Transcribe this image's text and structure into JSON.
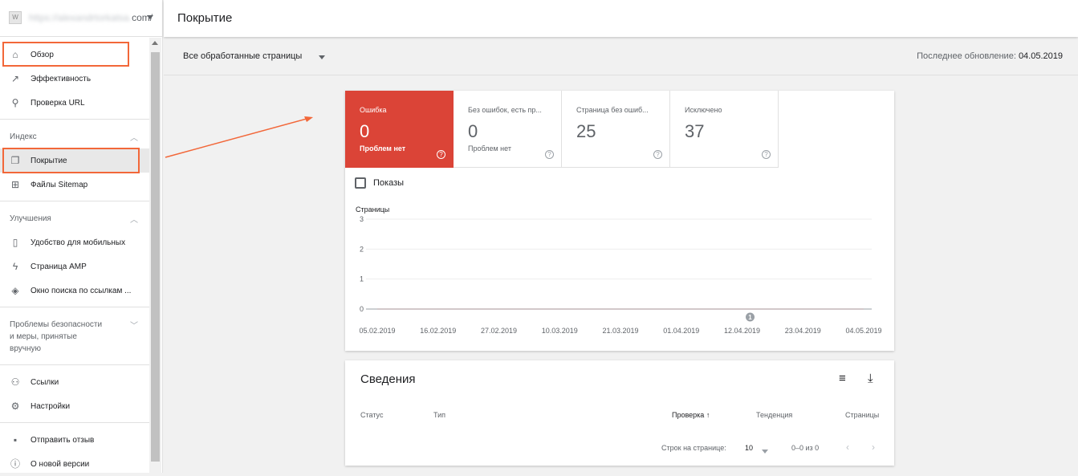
{
  "property": {
    "favicon_text": "W",
    "url_blurred": "https://alexandrtorkatsa.",
    "url_tail": "com/"
  },
  "sidebar": {
    "items": [
      {
        "label": "Обзор",
        "icon": "home-icon"
      },
      {
        "label": "Эффективность",
        "icon": "trending-up-icon"
      },
      {
        "label": "Проверка URL",
        "icon": "search-icon"
      }
    ],
    "index_section": {
      "title": "Индекс",
      "items": [
        {
          "label": "Покрытие",
          "icon": "copy-pages-icon"
        },
        {
          "label": "Файлы Sitemap",
          "icon": "sitemap-icon"
        }
      ]
    },
    "improvements_section": {
      "title": "Улучшения",
      "items": [
        {
          "label": "Удобство для мобильных",
          "icon": "phone-icon"
        },
        {
          "label": "Страница AMP",
          "icon": "bolt-icon"
        },
        {
          "label": "Окно поиска по ссылкам ...",
          "icon": "layers-icon"
        }
      ]
    },
    "security_section": {
      "title_line1": "Проблемы безопасности",
      "title_line2": "и меры, принятые",
      "title_line3": "вручную"
    },
    "bottom_items": [
      {
        "label": "Ссылки",
        "icon": "links-icon"
      },
      {
        "label": "Настройки",
        "icon": "gear-icon"
      }
    ],
    "footer_items": [
      {
        "label": "Отправить отзыв",
        "icon": "feedback-icon"
      },
      {
        "label": "О новой версии",
        "icon": "info-icon"
      }
    ]
  },
  "header": {
    "title": "Покрытие"
  },
  "filter": {
    "selected": "Все обработанные страницы",
    "last_update_label": "Последнее обновление:",
    "last_update_date": "04.05.2019"
  },
  "tiles": [
    {
      "name": "Ошибка",
      "value": "0",
      "sub": "Проблем нет",
      "color": "#db4437"
    },
    {
      "name": "Без ошибок, есть пр...",
      "value": "0",
      "sub": "Проблем нет"
    },
    {
      "name": "Страница без ошиб...",
      "value": "25",
      "sub": ""
    },
    {
      "name": "Исключено",
      "value": "37",
      "sub": ""
    }
  ],
  "help_glyph": "?",
  "impressions_label": "Показы",
  "chart_data": {
    "type": "line",
    "ylabel": "Страницы",
    "ylim": [
      0,
      3
    ],
    "yticks": [
      "3",
      "2",
      "1",
      "0"
    ],
    "x_ticks": [
      "05.02.2019",
      "16.02.2019",
      "27.02.2019",
      "10.03.2019",
      "21.03.2019",
      "01.04.2019",
      "12.04.2019",
      "23.04.2019",
      "04.05.2019"
    ],
    "series": [
      {
        "values": [
          0,
          0,
          0,
          0,
          0,
          0,
          0,
          0,
          0
        ],
        "color": "#db4437"
      }
    ],
    "annotation": {
      "label": "1",
      "x_index": 6
    }
  },
  "details": {
    "title": "Сведения",
    "columns": {
      "status": "Статус",
      "type": "Тип",
      "check": "Проверка",
      "trend": "Тенденция",
      "pages": "Страницы"
    },
    "sort_arrow": "↑",
    "rows_per_page_label": "Строк на странице:",
    "rows_per_page": "10",
    "range": "0–0 из 0"
  }
}
